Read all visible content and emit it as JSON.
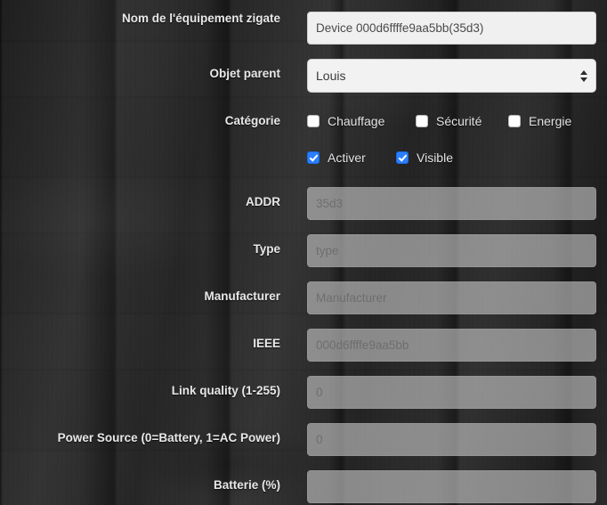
{
  "theme": {
    "background_color": "#2a2a2a",
    "label_color": "#e8e8e8",
    "accent_checkbox_color": "#2a7fff",
    "input_enabled_bg": "#f0f0f0",
    "input_disabled_bg": "#c8c8c8"
  },
  "form": {
    "name_field": {
      "label": "Nom de l'équipement zigate",
      "value": "Device 000d6ffffe9aa5bb(35d3)",
      "placeholder": "",
      "enabled": true
    },
    "parent_field": {
      "label": "Objet parent",
      "selected": "Louis"
    },
    "category": {
      "label": "Catégorie",
      "options": [
        {
          "label": "Chauffage",
          "checked": false
        },
        {
          "label": "Sécurité",
          "checked": false
        },
        {
          "label": "Energie",
          "checked": false
        }
      ]
    },
    "toggles": [
      {
        "label": "Activer",
        "checked": true
      },
      {
        "label": "Visible",
        "checked": true
      }
    ],
    "fields": [
      {
        "label": "ADDR",
        "value": "",
        "placeholder": "35d3",
        "enabled": false
      },
      {
        "label": "Type",
        "value": "",
        "placeholder": "type",
        "enabled": false
      },
      {
        "label": "Manufacturer",
        "value": "",
        "placeholder": "Manufacturer",
        "enabled": false
      },
      {
        "label": "IEEE",
        "value": "",
        "placeholder": "000d6ffffe9aa5bb",
        "enabled": false
      },
      {
        "label": "Link quality (1-255)",
        "value": "",
        "placeholder": "0",
        "enabled": false
      },
      {
        "label": "Power Source (0=Battery, 1=AC Power)",
        "value": "",
        "placeholder": "0",
        "enabled": false
      },
      {
        "label": "Batterie (%)",
        "value": "",
        "placeholder": "",
        "enabled": false
      }
    ]
  }
}
